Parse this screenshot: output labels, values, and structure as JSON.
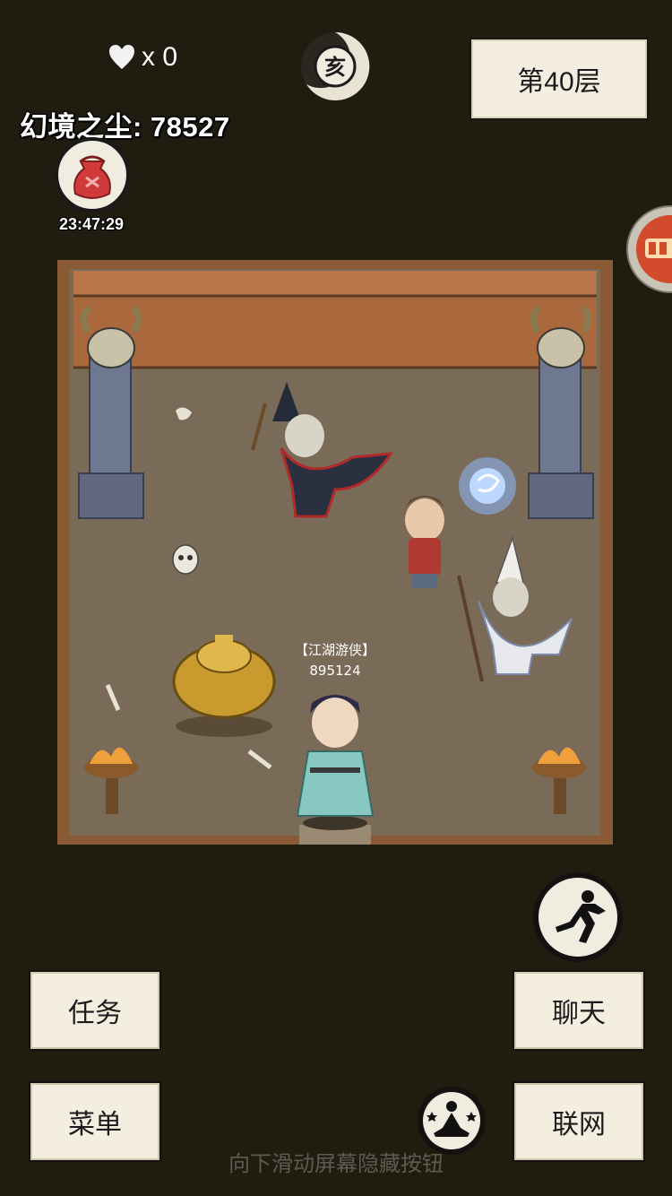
{
  "hud": {
    "lives_text": "x 0",
    "time_badge_char": "亥",
    "floor_label": "第40层",
    "dust_label": "幻境之尘: 78527",
    "bag_timer": "23:47:29"
  },
  "scene": {
    "player_title": "【江湖游侠】",
    "player_power": "895124"
  },
  "controls": {
    "task_label": "任务",
    "menu_label": "菜单",
    "chat_label": "聊天",
    "network_label": "联网",
    "hint_text": "向下滑动屏幕隐藏按钮"
  },
  "colors": {
    "background": "#201c10",
    "button_bg": "#f3eedf",
    "wall": "#a9693d",
    "floor": "#7a6b58"
  },
  "icons": [
    "heart-icon",
    "zodiac-time-icon",
    "lucky-bag-icon",
    "floating-menu-icon",
    "sprint-icon",
    "meditate-icon"
  ]
}
